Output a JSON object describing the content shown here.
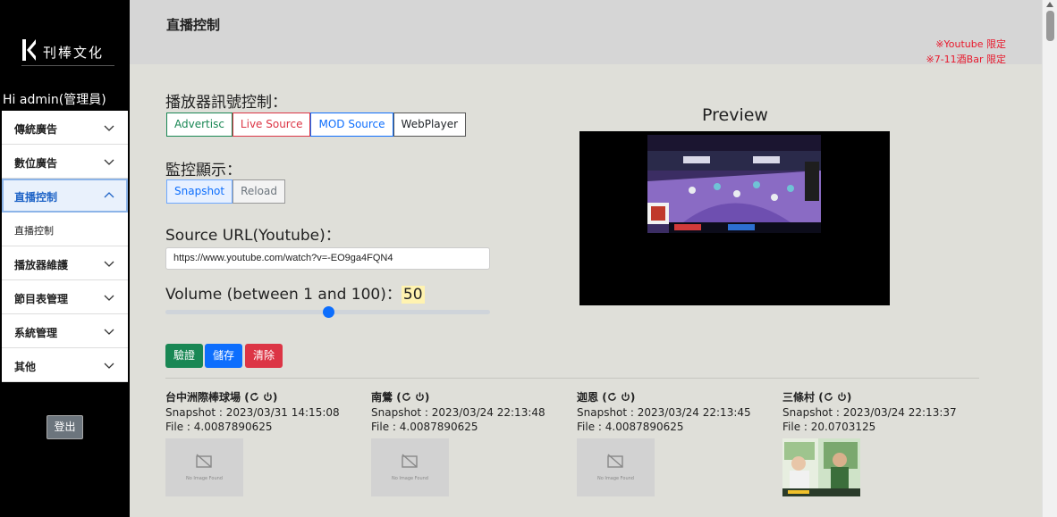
{
  "brand": {
    "name": "刊棒文化",
    "logo_icon": "k-logo-icon"
  },
  "sidebar": {
    "greeting": "Hi admin(管理員)",
    "items": [
      {
        "label": "傳統廣告",
        "icon": "chevron-down-icon"
      },
      {
        "label": "數位廣告",
        "icon": "chevron-down-icon"
      },
      {
        "label": "直播控制",
        "icon": "chevron-up-icon"
      },
      {
        "label": "直播控制"
      },
      {
        "label": "播放器維護",
        "icon": "chevron-down-icon"
      },
      {
        "label": "節目表管理",
        "icon": "chevron-down-icon"
      },
      {
        "label": "系統管理",
        "icon": "chevron-down-icon"
      },
      {
        "label": "其他",
        "icon": "chevron-down-icon"
      }
    ],
    "logout": "登出"
  },
  "header": {
    "title": "直播控制",
    "note1": "※Youtube 限定",
    "note2": "※7-11酒Bar 限定"
  },
  "player_signal": {
    "label": "播放器訊號控制：",
    "buttons": [
      "Advertisc",
      "Live Source",
      "MOD Source",
      "WebPlayer"
    ]
  },
  "monitor": {
    "label": "監控顯示：",
    "buttons": [
      "Snapshot",
      "Reload"
    ]
  },
  "source": {
    "label": "Source URL(Youtube)：",
    "value": "https://www.youtube.com/watch?v=-EO9ga4FQN4"
  },
  "volume": {
    "label": "Volume (between 1 and 100)：",
    "value": "50",
    "level_percent": 50
  },
  "actions": {
    "verify": "驗證",
    "save": "儲存",
    "clear": "清除"
  },
  "preview": {
    "title": "Preview"
  },
  "devices": [
    {
      "name": "台中洲際棒球場",
      "snapshot": "Snapshot : 2023/03/31 14:15:08",
      "file": "File : 4.0087890625",
      "image": "No Image Found"
    },
    {
      "name": "南鶯",
      "snapshot": "Snapshot : 2023/03/24 22:13:48",
      "file": "File : 4.0087890625",
      "image": "No Image Found"
    },
    {
      "name": "迦恩",
      "snapshot": "Snapshot : 2023/03/24 22:13:45",
      "file": "File : 4.0087890625",
      "image": "No Image Found"
    },
    {
      "name": "三條村",
      "snapshot": "Snapshot : 2023/03/24 22:13:37",
      "file": "File : 20.0703125",
      "image": ""
    }
  ],
  "colors": {
    "sidebar_bg": "#000000",
    "accent": "#0d6efd",
    "danger": "#dc3545",
    "success": "#198754"
  }
}
